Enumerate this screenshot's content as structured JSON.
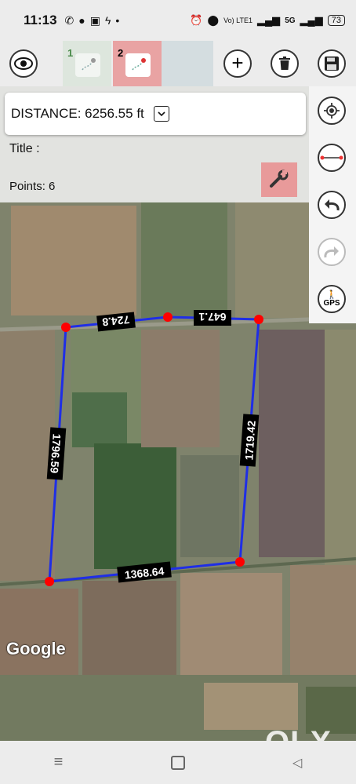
{
  "status": {
    "time": "11:13",
    "net_label": "Vo) LTE1",
    "signal_label": "5G",
    "battery": "73"
  },
  "toolbar": {
    "tab1_number": "1",
    "tab2_number": "2"
  },
  "panel": {
    "distance_text": "DISTANCE: 6256.55 ft",
    "title_label": "Title :",
    "points_label": "Points: 6"
  },
  "side": {
    "gps_label": "GPS"
  },
  "map": {
    "attribution": "Google",
    "segments": [
      "724.8",
      "647.1",
      "1719.42",
      "1368.64",
      "1796.59"
    ]
  },
  "watermark": "OLX",
  "colors": {
    "polygon": "#1f2ee6",
    "vertex": "#ff0000",
    "active_tab": "#e9a3a3",
    "wrench_bg": "#e89a9a"
  }
}
